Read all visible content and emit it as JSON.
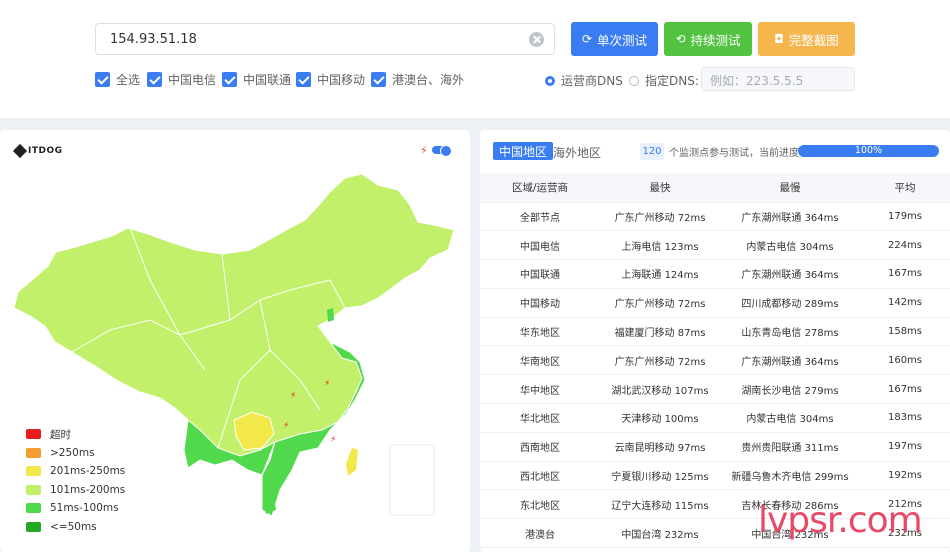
{
  "search": {
    "value": "154.93.51.18"
  },
  "buttons": {
    "single": "单次测试",
    "continuous": "持续测试",
    "screenshot": "完整截图"
  },
  "isps": [
    {
      "label": "全选",
      "checked": true
    },
    {
      "label": "中国电信",
      "checked": true
    },
    {
      "label": "中国联通",
      "checked": true
    },
    {
      "label": "中国移动",
      "checked": true
    },
    {
      "label": "港澳台、海外",
      "checked": true
    }
  ],
  "dns": {
    "isp_dns": "运营商DNS",
    "custom_dns": "指定DNS:",
    "placeholder": "例如：223.5.5.5",
    "selected": "isp_dns"
  },
  "map": {
    "logo": "ITDOG",
    "legend": [
      {
        "label": "超时",
        "color": "#e81e1e"
      },
      {
        "label": ">250ms",
        "color": "#f59d32"
      },
      {
        "label": "201ms-250ms",
        "color": "#f3e84a"
      },
      {
        "label": "101ms-200ms",
        "color": "#c3f06a"
      },
      {
        "label": "51ms-100ms",
        "color": "#50d94a"
      },
      {
        "label": "<=50ms",
        "color": "#24a824"
      }
    ]
  },
  "results": {
    "tabs": [
      "中国地区",
      "海外地区"
    ],
    "active_tab": "中国地区",
    "node_count": "120",
    "count_text": "个监测点参与测试，当前进度：",
    "progress": "100%",
    "progress_value": 1.0,
    "headers": [
      "区域/运营商",
      "最快",
      "最慢",
      "平均"
    ],
    "rows": [
      [
        "全部节点",
        "广东广州移动 72ms",
        "广东潮州联通 364ms",
        "179ms"
      ],
      [
        "中国电信",
        "上海电信 123ms",
        "内蒙古电信 304ms",
        "224ms"
      ],
      [
        "中国联通",
        "上海联通 124ms",
        "广东潮州联通 364ms",
        "167ms"
      ],
      [
        "中国移动",
        "广东广州移动 72ms",
        "四川成都移动 289ms",
        "142ms"
      ],
      [
        "华东地区",
        "福建厦门移动 87ms",
        "山东青岛电信 278ms",
        "158ms"
      ],
      [
        "华南地区",
        "广东广州移动 72ms",
        "广东潮州联通 364ms",
        "160ms"
      ],
      [
        "华中地区",
        "湖北武汉移动 107ms",
        "湖南长沙电信 279ms",
        "167ms"
      ],
      [
        "华北地区",
        "天津移动 100ms",
        "内蒙古电信 304ms",
        "183ms"
      ],
      [
        "西南地区",
        "云南昆明移动 97ms",
        "贵州贵阳联通 311ms",
        "197ms"
      ],
      [
        "西北地区",
        "宁夏银川移动 125ms",
        "新疆乌鲁木齐电信 299ms",
        "192ms"
      ],
      [
        "东北地区",
        "辽宁大连移动 115ms",
        "吉林长春移动 286ms",
        "212ms"
      ],
      [
        "港澳台",
        "中国台湾 232ms",
        "中国台湾 232ms",
        "232ms"
      ]
    ]
  },
  "watermark": "lvpsr.com"
}
